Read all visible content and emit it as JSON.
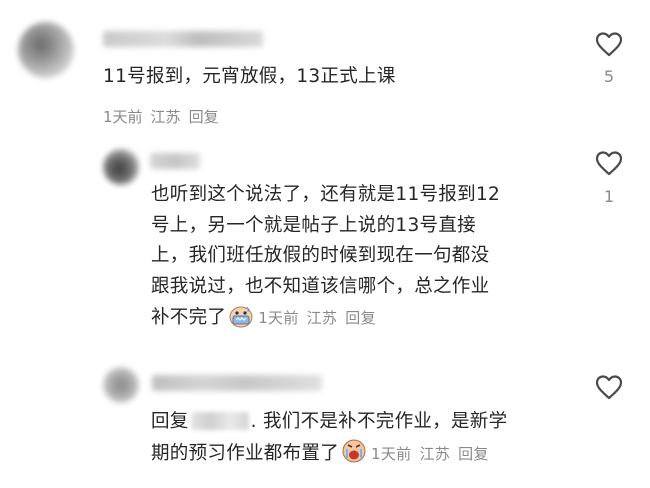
{
  "comments": [
    {
      "text": "11号报到，元宵放假，13正式上课",
      "date": "1天前",
      "location": "江苏",
      "reply_label": "回复",
      "likes": "5"
    },
    {
      "text_lines": [
        "也听到这个说法了，还有就是11号报到12",
        "号上，另一个就是帖子上说的13号直接",
        "上，我们班任放假的时候到现在一句都没",
        "跟我说过，也不知道该信哪个，总之作业"
      ],
      "last_line": "补不完了",
      "date": "1天前",
      "location": "江苏",
      "reply_label": "回复",
      "likes": "1"
    },
    {
      "prefix": "回复",
      "line1": ". 我们不是补不完作业，是新学",
      "line2": "期的预习作业都布置了",
      "date": "1天前",
      "location": "江苏",
      "reply_label": "回复"
    }
  ],
  "icons": {
    "like": "heart-outline-icon",
    "emoji_sweat": "nervous-face-emoji",
    "emoji_cry": "crying-face-emoji"
  },
  "colors": {
    "text": "#262626",
    "meta": "#8a8a8a",
    "heart": "#4a4a4a"
  }
}
